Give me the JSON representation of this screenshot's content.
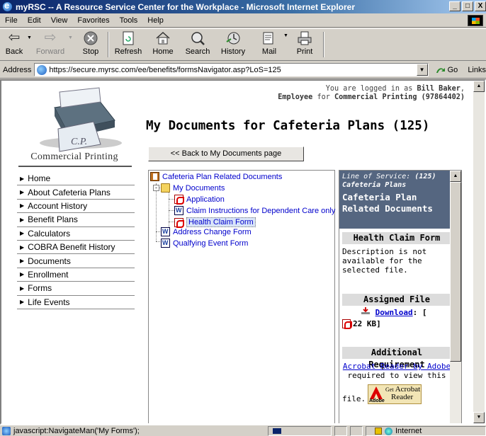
{
  "window": {
    "title": "myRSC -- A Resource Service Center for the Workplace - Microsoft Internet Explorer",
    "minimize": "_",
    "maximize": "□",
    "close": "X"
  },
  "menu": [
    "File",
    "Edit",
    "View",
    "Favorites",
    "Tools",
    "Help"
  ],
  "toolbar": {
    "back": "Back",
    "forward": "Forward",
    "stop": "Stop",
    "refresh": "Refresh",
    "home": "Home",
    "search": "Search",
    "history": "History",
    "mail": "Mail",
    "print": "Print"
  },
  "address": {
    "label": "Address",
    "url": "https://secure.myrsc.com/ee/benefits/formsNavigator.asp?LoS=125",
    "go": "Go",
    "links": "Links"
  },
  "company": {
    "name": "Commercial Printing",
    "logo_initials": "C.P."
  },
  "nav": [
    "Home",
    "About Cafeteria Plans",
    "Account History",
    "Benefit Plans",
    "Calculators",
    "COBRA Benefit History",
    "Documents",
    "Enrollment",
    "Forms",
    "Life Events"
  ],
  "login": {
    "line1_prefix": "You are logged in as",
    "user": "Bill Baker",
    "line1_suffix": ",",
    "role": "Employee",
    "line2_mid": "for",
    "org": "Commercial Printing (97864402)"
  },
  "page_title": "My Documents for Cafeteria Plans (125)",
  "back_button": "<< Back to My Documents page",
  "tree": {
    "root": "Cafeteria Plan Related Documents",
    "folder": "My Documents",
    "items": [
      "Application",
      "Claim Instructions for Dependent Care only",
      "Health Claim Form"
    ],
    "other": [
      "Address Change Form",
      "Qualfying Event Form"
    ]
  },
  "detail": {
    "line_of_service_label": "Line of Service:",
    "line_of_service_value": "(125) Cafeteria Plans",
    "category": "Cafeteria Plan Related Documents",
    "doc_title": "Health Claim Form",
    "description": "Description is not available for the selected file.",
    "assigned_file_heading": "Assigned File",
    "download": "Download",
    "download_suffix": ": [",
    "file_size": "22 KB]",
    "additional_heading": "Additional Requirement",
    "reader_link": "Acrobat Reader by Adobe",
    "reader_text": "required to view this",
    "file_word": "file.",
    "badge_get": "Get",
    "badge_acrobat": "Acrobat",
    "badge_reader": "Reader",
    "badge_adobe": "Adobe"
  },
  "status": {
    "text": "javascript:NavigateMan('My Forms');",
    "zone": "Internet"
  },
  "colors": {
    "titlebar": "#0a246a",
    "detail_header": "#556680",
    "link": "#0000cc"
  }
}
